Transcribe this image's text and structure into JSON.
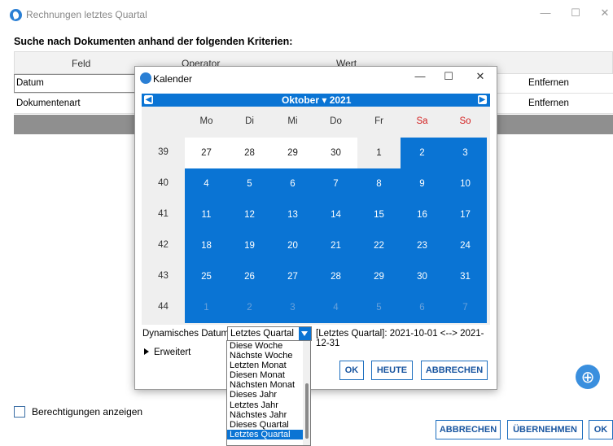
{
  "window": {
    "title": "Rechnungen letztes Quartal",
    "minimize": "—",
    "maximize": "☐",
    "close": "✕"
  },
  "heading": "Suche nach Dokumenten anhand der folgenden Kriterien:",
  "grid": {
    "columns": [
      "Feld",
      "Operator",
      "Wert"
    ],
    "rows": [
      {
        "feld": "Datum",
        "action": "Entfernen"
      },
      {
        "feld": "Dokumentenart",
        "action": "Entfernen"
      }
    ]
  },
  "permissions_label": "Berechtigungen anzeigen",
  "footer": {
    "cancel": "ABBRECHEN",
    "apply": "ÜBERNEHMEN",
    "ok": "OK"
  },
  "calendar": {
    "title": "Kalender",
    "month_year": "Oktober ▾ 2021",
    "weekdays": [
      "Mo",
      "Di",
      "Mi",
      "Do",
      "Fr",
      "Sa",
      "So"
    ],
    "weeks": [
      {
        "nr": "39",
        "days": [
          "27",
          "28",
          "29",
          "30",
          "1",
          "2",
          "3"
        ]
      },
      {
        "nr": "40",
        "days": [
          "4",
          "5",
          "6",
          "7",
          "8",
          "9",
          "10"
        ]
      },
      {
        "nr": "41",
        "days": [
          "11",
          "12",
          "13",
          "14",
          "15",
          "16",
          "17"
        ]
      },
      {
        "nr": "42",
        "days": [
          "18",
          "19",
          "20",
          "21",
          "22",
          "23",
          "24"
        ]
      },
      {
        "nr": "43",
        "days": [
          "25",
          "26",
          "27",
          "28",
          "29",
          "30",
          "31"
        ]
      },
      {
        "nr": "44",
        "days": [
          "1",
          "2",
          "3",
          "4",
          "5",
          "6",
          "7"
        ]
      }
    ],
    "dynamic_label": "Dynamisches Datum",
    "dynamic_value": "Letztes Quartal",
    "range_text": "[Letztes Quartal]: 2021-10-01 <--> 2021-12-31",
    "advanced": "Erweitert",
    "btn_ok": "OK",
    "btn_today": "HEUTE",
    "btn_cancel": "ABBRECHEN",
    "options": [
      "Diese Woche",
      "Nächste Woche",
      "Letzten Monat",
      "Diesen Monat",
      "Nächsten Monat",
      "Dieses Jahr",
      "Letztes Jahr",
      "Nächstes Jahr",
      "Dieses Quartal",
      "Letztes Quartal"
    ],
    "selected_option": "Letztes Quartal"
  },
  "colors": {
    "accent": "#0a74d4",
    "weekend": "#d32020",
    "grid_bar": "#8f8f8f"
  }
}
